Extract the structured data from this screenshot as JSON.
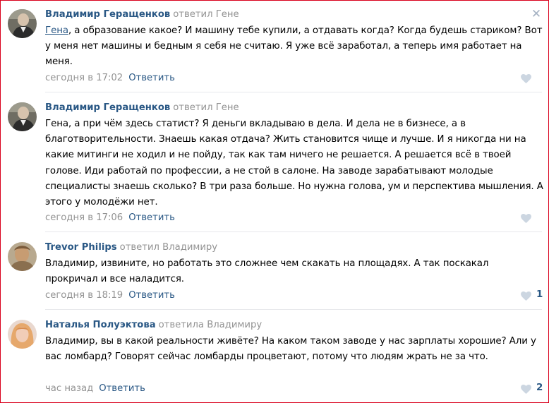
{
  "close_symbol": "✕",
  "colors": {
    "link": "#2a5885",
    "muted": "#939393",
    "frame": "#d9001b"
  },
  "comments": [
    {
      "author": "Владимир Геращенков",
      "replied_to": "ответил Гене",
      "mention": "Гена",
      "text": ", а образование какое? И машину тебе купили, а отдавать когда? Когда будешь стариком? Вот у меня нет машины и бедным я себя не считаю. Я уже всё заработал, а теперь имя работает на меня.",
      "time": "сегодня в 17:02",
      "reply_label": "Ответить",
      "likes": ""
    },
    {
      "author": "Владимир Геращенков",
      "replied_to": "ответил Гене",
      "text": "Гена, а при чём здесь статист? Я деньги вкладываю в дела. И дела не в бизнесе, а в благотворительности. Знаешь какая отдача? Жить становится чище и лучше. И я никогда ни на какие митинги не ходил и не пойду, так как там ничего не решается. А решается всё в твоей голове. Иди работай по профессии, а не стой в салоне. На заводе зарабатывают молодые специалисты знаешь сколько? В три раза больше. Но нужна голова, ум и перспектива мышления. А этого у молодёжи нет.",
      "time": "сегодня в 17:06",
      "reply_label": "Ответить",
      "likes": ""
    },
    {
      "author": "Trevor Philips",
      "replied_to": "ответил Владимиру",
      "text": "Владимир, извините, но работать это сложнее чем скакать на площадях. А так поскакал прокричал и все наладится.",
      "time": "сегодня в 18:19",
      "reply_label": "Ответить",
      "likes": "1"
    },
    {
      "author": "Наталья Полуэктова",
      "replied_to": "ответила Владимиру",
      "text": "Владимир, вы в какой реальности живёте? На каком таком заводе у нас зарплаты хорошие? Али у вас ломбард? Говорят сейчас ломбарды процветают, потому что людям жрать не за что.",
      "time": "час назад",
      "reply_label": "Ответить",
      "likes": "2"
    }
  ]
}
